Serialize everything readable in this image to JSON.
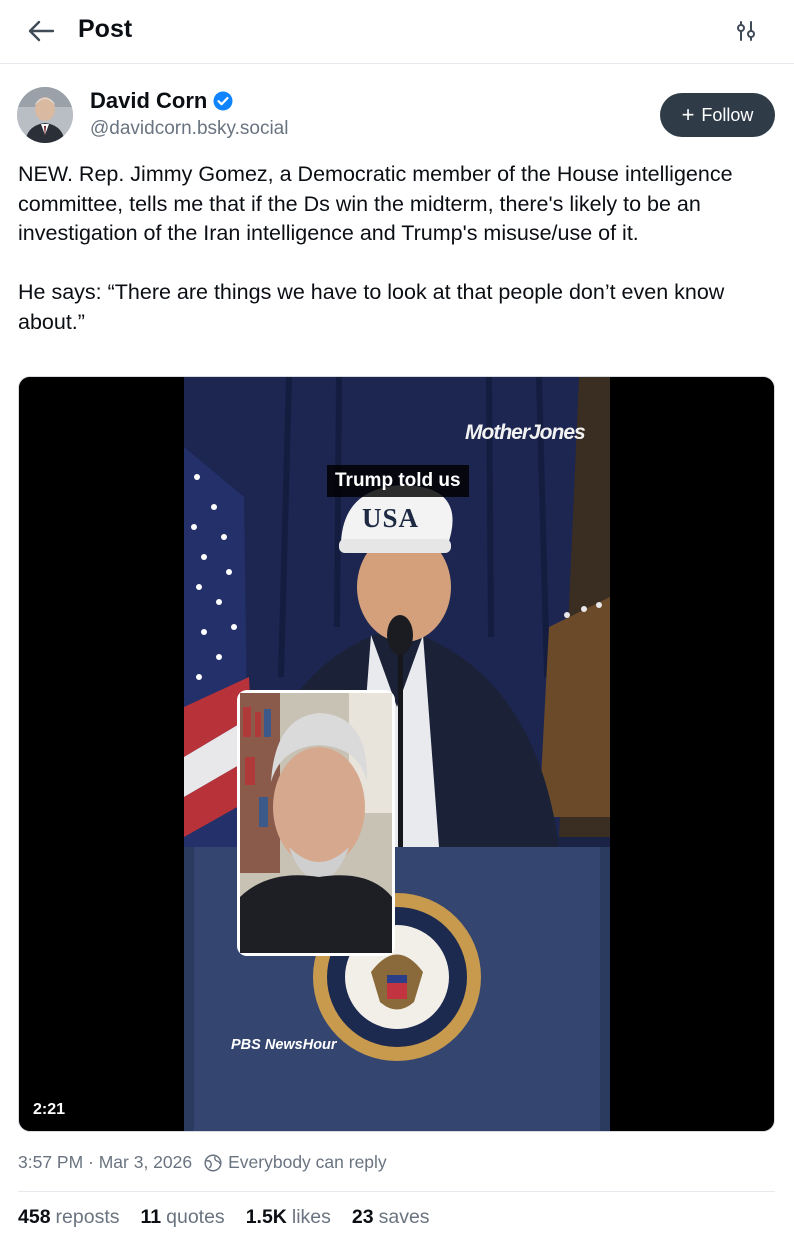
{
  "header": {
    "title": "Post",
    "back_icon": "arrow-left-icon",
    "filter_icon": "sliders-icon"
  },
  "author": {
    "name": "David Corn",
    "handle": "@davidcorn.bsky.social",
    "verified": true,
    "verified_color": "#1083fe"
  },
  "follow_button": {
    "label": "Follow",
    "icon": "plus-icon",
    "background": "#2f3b47"
  },
  "post": {
    "text": "NEW. Rep. Jimmy Gomez, a Democratic member of the House intelligence committee, tells me that if the Ds win the midterm, there's likely to be an investigation of the Iran intelligence and Trump's misuse/use of it.\n\nHe says: “There are things we have to look at that people don’t even know about.”"
  },
  "video": {
    "logo_text": "MotherJones",
    "caption": "Trump told us",
    "hat_text": "USA",
    "source_label": "PBS NewsHour",
    "duration": "2:21"
  },
  "meta": {
    "timestamp": "3:57 PM · Mar 3, 2026",
    "reply_setting": "Everybody can reply",
    "reply_icon": "globe-icon"
  },
  "stats": [
    {
      "value": "458",
      "label": "reposts"
    },
    {
      "value": "11",
      "label": "quotes"
    },
    {
      "value": "1.5K",
      "label": "likes"
    },
    {
      "value": "23",
      "label": "saves"
    }
  ]
}
